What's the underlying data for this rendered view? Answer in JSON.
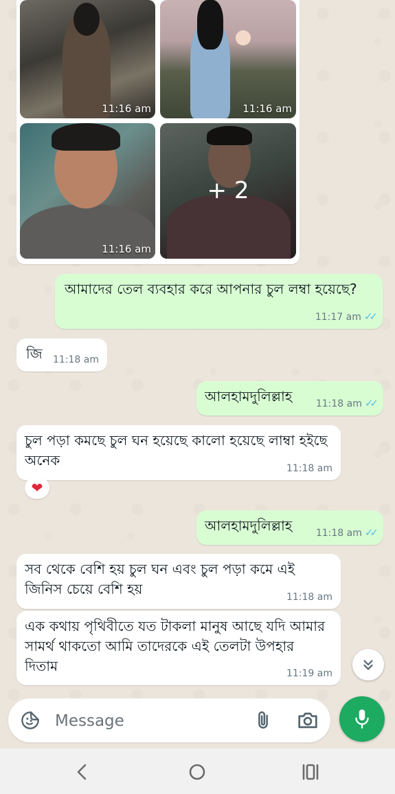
{
  "gallery": {
    "images": [
      {
        "time": "11:16 am",
        "subject": "woman-indoor-photo"
      },
      {
        "time": "11:16 am",
        "subject": "woman-field-sunset-photo"
      },
      {
        "time": "11:16 am",
        "subject": "man-selfie-photo"
      },
      {
        "subject": "man-selfie-photo-2",
        "overlay": "+ 2"
      }
    ]
  },
  "messages": [
    {
      "dir": "out",
      "text": "আমাদের তেল ব্যবহার করে আপনার চুল লম্বা হয়েছে?",
      "time": "11:17 am"
    },
    {
      "dir": "in",
      "text": "জি",
      "time": "11:18 am"
    },
    {
      "dir": "out",
      "text": "আলহামদুলিল্লাহ",
      "time": "11:18 am"
    },
    {
      "dir": "in",
      "text": "চুল পড়া কমছে চুল ঘন হয়েছে কালো হয়েছে লাম্বা হইছে অনেক",
      "time": "11:18 am",
      "reaction": "❤"
    },
    {
      "dir": "out",
      "text": "আলহামদুলিল্লাহ",
      "time": "11:18 am"
    },
    {
      "dir": "in",
      "text": "সব থেকে বেশি হয় চুল ঘন এবং চুল পড়া কমে এই জিনিস চেয়ে বেশি হয়",
      "time": "11:18 am"
    },
    {
      "dir": "in",
      "text": "এক কথায় পৃথিবীতে যত টাকলা মানুষ আছে যদি আমার সামর্থ থাকতো আমি তাদেরকে এই তেলটা উপহার দিতাম",
      "time": "11:19 am"
    }
  ],
  "read_receipt": "✓✓",
  "input": {
    "placeholder": "Message"
  },
  "icons": {
    "emoji": "sticker-icon",
    "attach": "paperclip-icon",
    "camera": "camera-icon",
    "mic": "mic-icon",
    "scroll": "chevron-double-down-icon"
  },
  "colors": {
    "accent": "#1daa61",
    "outgoing": "#d9fdd3",
    "incoming": "#ffffff",
    "tick": "#53bdeb"
  }
}
